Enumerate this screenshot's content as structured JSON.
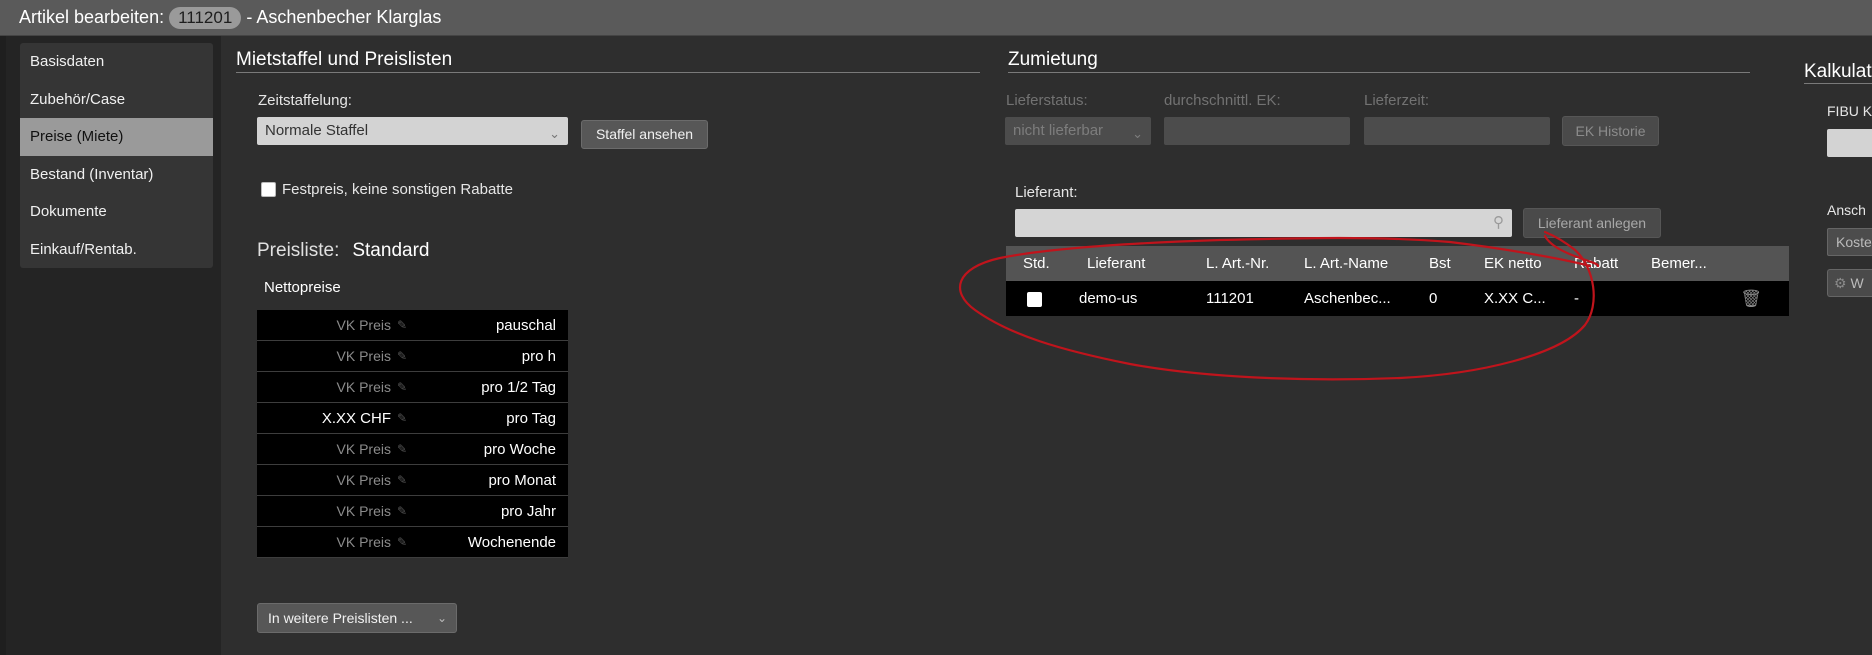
{
  "window": {
    "title_prefix": "Artikel bearbeiten:",
    "article_id": "111201",
    "title_suffix": "- Aschenbecher Klarglas"
  },
  "sidebar": {
    "items": [
      {
        "label": "Basisdaten"
      },
      {
        "label": "Zubehör/Case"
      },
      {
        "label": "Preise (Miete)",
        "active": true
      },
      {
        "label": "Bestand (Inventar)"
      },
      {
        "label": "Dokumente"
      },
      {
        "label": "Einkauf/Rentab."
      }
    ]
  },
  "mietstaffel": {
    "title": "Mietstaffel und Preislisten",
    "zeitstaffelung_label": "Zeitstaffelung:",
    "zeitstaffelung_value": "Normale Staffel",
    "staffel_button": "Staffel ansehen",
    "festpreis_label": "Festpreis, keine sonstigen Rabatte",
    "festpreis_checked": false,
    "preisliste_label": "Preisliste:",
    "preisliste_name": "Standard",
    "nettopreise_label": "Nettopreise",
    "prices": [
      {
        "value": "VK Preis",
        "unit": "pauschal",
        "set": false
      },
      {
        "value": "VK Preis",
        "unit": "pro h",
        "set": false
      },
      {
        "value": "VK Preis",
        "unit": "pro 1/2 Tag",
        "set": false
      },
      {
        "value": "X.XX CHF",
        "unit": "pro Tag",
        "set": true
      },
      {
        "value": "VK Preis",
        "unit": "pro Woche",
        "set": false
      },
      {
        "value": "VK Preis",
        "unit": "pro Monat",
        "set": false
      },
      {
        "value": "VK Preis",
        "unit": "pro Jahr",
        "set": false
      },
      {
        "value": "VK Preis",
        "unit": "Wochenende",
        "set": false
      }
    ],
    "weitere_button": "In weitere Preislisten ..."
  },
  "zumietung": {
    "title": "Zumietung",
    "lieferstatus_label": "Lieferstatus:",
    "lieferstatus_value": "nicht lieferbar",
    "ek_label": "durchschnittl. EK:",
    "lieferzeit_label": "Lieferzeit:",
    "ek_historie_button": "EK Historie",
    "lieferant_label": "Lieferant:",
    "lieferant_anlegen_button": "Lieferant anlegen",
    "table": {
      "headers": [
        "Std.",
        "Lieferant",
        "L. Art.-Nr.",
        "L. Art.-Name",
        "Bst",
        "EK netto",
        "Rabatt",
        "Bemer..."
      ],
      "rows": [
        {
          "lieferant": "demo-us",
          "art_nr": "111201",
          "art_name": "Aschenbec...",
          "bst": "0",
          "ek_netto": "X.XX C...",
          "rabatt": "-",
          "bemerkung": ""
        }
      ]
    }
  },
  "kalkulation": {
    "title": "Kalkulat",
    "fibu_label": "FIBU K",
    "ansch_label": "Ansch",
    "koste_value": "Koste",
    "w_button": "W"
  },
  "colors": {
    "annotation": "#c0141c",
    "active_nav": "#9a9a9a",
    "background": "#2e2e2e"
  }
}
